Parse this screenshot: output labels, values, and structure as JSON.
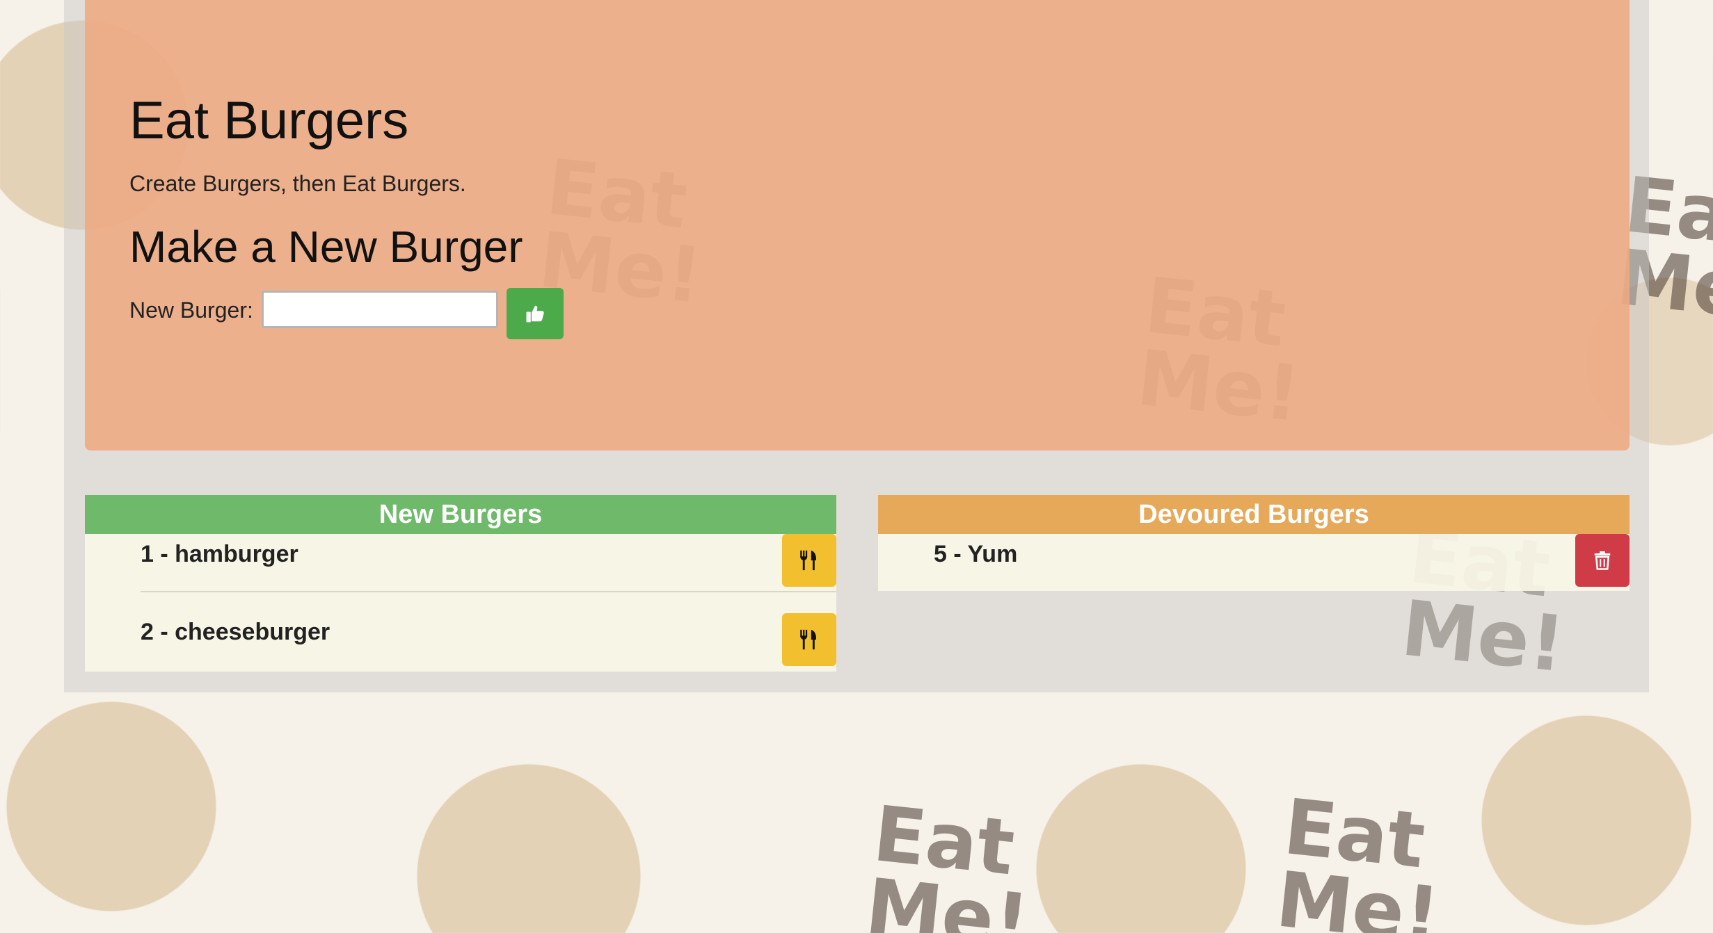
{
  "header": {
    "title": "Eat Burgers",
    "tagline": "Create Burgers, then Eat Burgers.",
    "form_title": "Make a New Burger",
    "input_label": "New Burger:",
    "input_value": "",
    "submit_icon": "thumbs-up-icon"
  },
  "new_burgers": {
    "title": "New Burgers",
    "items": [
      {
        "label": "1 - hamburger",
        "action_icon": "utensils-icon"
      },
      {
        "label": "2 - cheeseburger",
        "action_icon": "utensils-icon"
      }
    ]
  },
  "devoured_burgers": {
    "title": "Devoured Burgers",
    "items": [
      {
        "label": "5 - Yum",
        "action_icon": "trash-icon"
      }
    ]
  },
  "background": {
    "pattern_text": "Eat Me!"
  },
  "colors": {
    "jumbotron": "#eeaa82",
    "new_header": "#6fb96a",
    "devoured_header": "#e6a95a",
    "submit": "#4caa4a",
    "eat_button": "#f2c02e",
    "delete_button": "#cf3c48"
  }
}
